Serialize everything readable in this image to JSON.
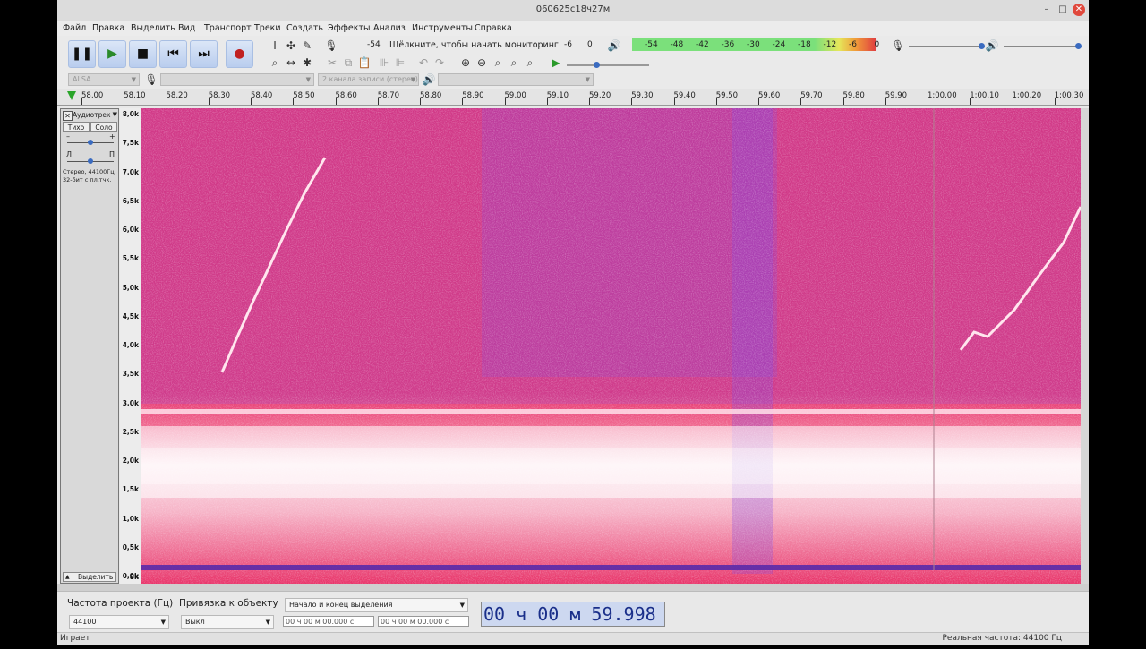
{
  "window": {
    "title": "060625с18ч27м",
    "minimize": "–",
    "maximize": "□",
    "close": "✕"
  },
  "menu": [
    "Файл",
    "Правка",
    "Выделить",
    "Вид",
    "Транспорт",
    "Треки",
    "Создать",
    "Эффекты",
    "Анализ",
    "Инструменты",
    "Справка"
  ],
  "transport": {
    "pause": "❚❚",
    "play": "▶",
    "stop": "■",
    "skip_start": "⏮",
    "skip_end": "⏭",
    "record": "●"
  },
  "icons": {
    "select": "select-tool-icon",
    "envelope": "envelope-tool-icon",
    "draw": "draw-tool-icon",
    "zoom": "zoom-tool-icon",
    "timeshift": "timeshift-tool-icon",
    "multi": "multi-tool-icon",
    "mic": "microphone-icon",
    "speaker": "speaker-icon"
  },
  "record_meter": {
    "left_label": "-54",
    "prompt": "Щёлкните, чтобы начать мониторинг",
    "mid": "-6",
    "end": "0"
  },
  "play_meter": {
    "scale": [
      "-54",
      "-48",
      "-42",
      "-36",
      "-30",
      "-24",
      "-18",
      "-12",
      "-6",
      "0"
    ]
  },
  "device": {
    "host": "ALSA",
    "channels": "2 канала записи (стерео)"
  },
  "ruler": {
    "labels": [
      "58,00",
      "58,10",
      "58,20",
      "58,30",
      "58,40",
      "58,50",
      "58,60",
      "58,70",
      "58,80",
      "58,90",
      "59,00",
      "59,10",
      "59,20",
      "59,30",
      "59,40",
      "59,50",
      "59,60",
      "59,70",
      "59,80",
      "59,90",
      "1:00,00",
      "1:00,10",
      "1:00,20",
      "1:00,30"
    ]
  },
  "track": {
    "name": "Аудиотрек",
    "mute": "Тихо",
    "solo": "Соло",
    "gain_minus": "–",
    "gain_plus": "+",
    "pan_left": "Л",
    "pan_right": "П",
    "info1": "Стерео, 44100Гц",
    "info2": "32-бит с пл.тчк.",
    "select": "Выделить",
    "close": "✕",
    "collapse": "▲"
  },
  "freq_scale": [
    "8,0k",
    "7,5k",
    "7,0k",
    "6,5k",
    "6,0k",
    "5,5k",
    "5,0k",
    "4,5k",
    "4,0k",
    "3,5k",
    "3,0k",
    "2,5k",
    "2,0k",
    "1,5k",
    "1,0k",
    "0,5k",
    "0,0k",
    "8k"
  ],
  "bottom": {
    "project_rate_label": "Частота проекта (Гц)",
    "project_rate": "44100",
    "snap_label": "Привязка к объекту",
    "snap_value": "Выкл",
    "selection_mode": "Начало и конец выделения",
    "sel_start": "00 ч 00 м 00.000 с",
    "sel_end": "00 ч 00 м 00.000 с",
    "big_time": "00 ч 00 м 59.998 с"
  },
  "status": {
    "left": "Играет",
    "right": "Реальная частота: 44100 Гц"
  },
  "colors": {
    "spectrogram_bg": "#e8326a",
    "accent_blue": "#1a2f8a",
    "meter_green": "#7be07b"
  }
}
